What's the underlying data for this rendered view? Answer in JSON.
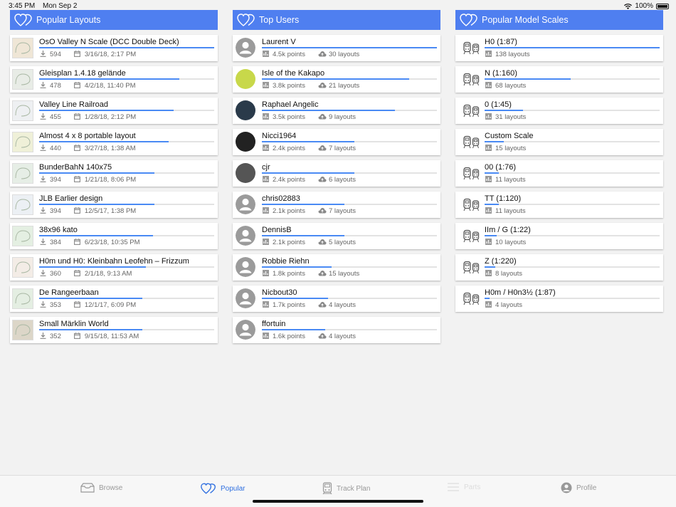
{
  "status": {
    "time": "3:45 PM",
    "date": "Mon Sep 2",
    "battery": "100%"
  },
  "colors": {
    "accent": "#4f7ff0",
    "bar": "#4a8af4",
    "active_tab": "#2f6fe0"
  },
  "popular_layouts": {
    "title": "Popular Layouts",
    "items": [
      {
        "title": "OsO Valley N Scale (DCC Double Deck)",
        "downloads": "594",
        "date": "3/16/18, 2:17 PM",
        "progress": 1.0
      },
      {
        "title": "Gleisplan 1.4.18 gelände",
        "downloads": "478",
        "date": "4/2/18, 11:40 PM",
        "progress": 0.8
      },
      {
        "title": "Valley Line Railroad",
        "downloads": "455",
        "date": "1/28/18, 2:12 PM",
        "progress": 0.77
      },
      {
        "title": "Almost 4 x 8 portable layout",
        "downloads": "440",
        "date": "3/27/18, 1:38 AM",
        "progress": 0.74
      },
      {
        "title": "BunderBahN 140x75",
        "downloads": "394",
        "date": "1/21/18, 8:06 PM",
        "progress": 0.66
      },
      {
        "title": "JLB Earlier design",
        "downloads": "394",
        "date": "12/5/17, 1:38 PM",
        "progress": 0.66
      },
      {
        "title": "38x96 kato",
        "downloads": "384",
        "date": "6/23/18, 10:35 PM",
        "progress": 0.65
      },
      {
        "title": "H0m und H0: Kleinbahn Leofehn – Frizzum",
        "downloads": "360",
        "date": "2/1/18, 9:13 AM",
        "progress": 0.61
      },
      {
        "title": "De Rangeerbaan",
        "downloads": "353",
        "date": "12/1/17, 6:09 PM",
        "progress": 0.59
      },
      {
        "title": "Small Märklin World",
        "downloads": "352",
        "date": "9/15/18, 11:53 AM",
        "progress": 0.59
      }
    ]
  },
  "top_users": {
    "title": "Top Users",
    "items": [
      {
        "name": "Laurent V",
        "points": "4.5k points",
        "layouts": "30 layouts",
        "progress": 1.0
      },
      {
        "name": "Isle of the Kakapo",
        "points": "3.8k points",
        "layouts": "21 layouts",
        "progress": 0.84
      },
      {
        "name": "Raphael Angelic",
        "points": "3.5k points",
        "layouts": "9 layouts",
        "progress": 0.76
      },
      {
        "name": "Nicci1964",
        "points": "2.4k points",
        "layouts": "7 layouts",
        "progress": 0.53
      },
      {
        "name": "cjr",
        "points": "2.4k points",
        "layouts": "6 layouts",
        "progress": 0.53
      },
      {
        "name": "chris02883",
        "points": "2.1k points",
        "layouts": "7 layouts",
        "progress": 0.47
      },
      {
        "name": "DennisB",
        "points": "2.1k points",
        "layouts": "5 layouts",
        "progress": 0.47
      },
      {
        "name": "Robbie Riehn",
        "points": "1.8k points",
        "layouts": "15 layouts",
        "progress": 0.4
      },
      {
        "name": "Nicbout30",
        "points": "1.7k points",
        "layouts": "4 layouts",
        "progress": 0.38
      },
      {
        "name": "ffortuin",
        "points": "1.6k points",
        "layouts": "4 layouts",
        "progress": 0.36
      }
    ]
  },
  "model_scales": {
    "title": "Popular Model Scales",
    "items": [
      {
        "name": "H0 (1:87)",
        "layouts": "138 layouts",
        "progress": 1.0
      },
      {
        "name": "N (1:160)",
        "layouts": "68 layouts",
        "progress": 0.49
      },
      {
        "name": "0 (1:45)",
        "layouts": "31 layouts",
        "progress": 0.22
      },
      {
        "name": "Custom Scale",
        "layouts": "15 layouts",
        "progress": 0.11
      },
      {
        "name": "00 (1:76)",
        "layouts": "11 layouts",
        "progress": 0.08
      },
      {
        "name": "TT (1:120)",
        "layouts": "11 layouts",
        "progress": 0.08
      },
      {
        "name": "IIm / G (1:22)",
        "layouts": "10 layouts",
        "progress": 0.07
      },
      {
        "name": "Z (1:220)",
        "layouts": "8 layouts",
        "progress": 0.06
      },
      {
        "name": "H0m / H0n3½ (1:87)",
        "layouts": "4 layouts",
        "progress": 0.03
      }
    ]
  },
  "tabs": [
    {
      "label": "Browse",
      "icon": "tray-icon",
      "state": "normal"
    },
    {
      "label": "Popular",
      "icon": "hearts-icon",
      "state": "active"
    },
    {
      "label": "Track Plan",
      "icon": "train-icon",
      "state": "normal"
    },
    {
      "label": "Parts",
      "icon": "list-icon",
      "state": "disabled"
    },
    {
      "label": "Profile",
      "icon": "person-icon",
      "state": "normal"
    }
  ]
}
